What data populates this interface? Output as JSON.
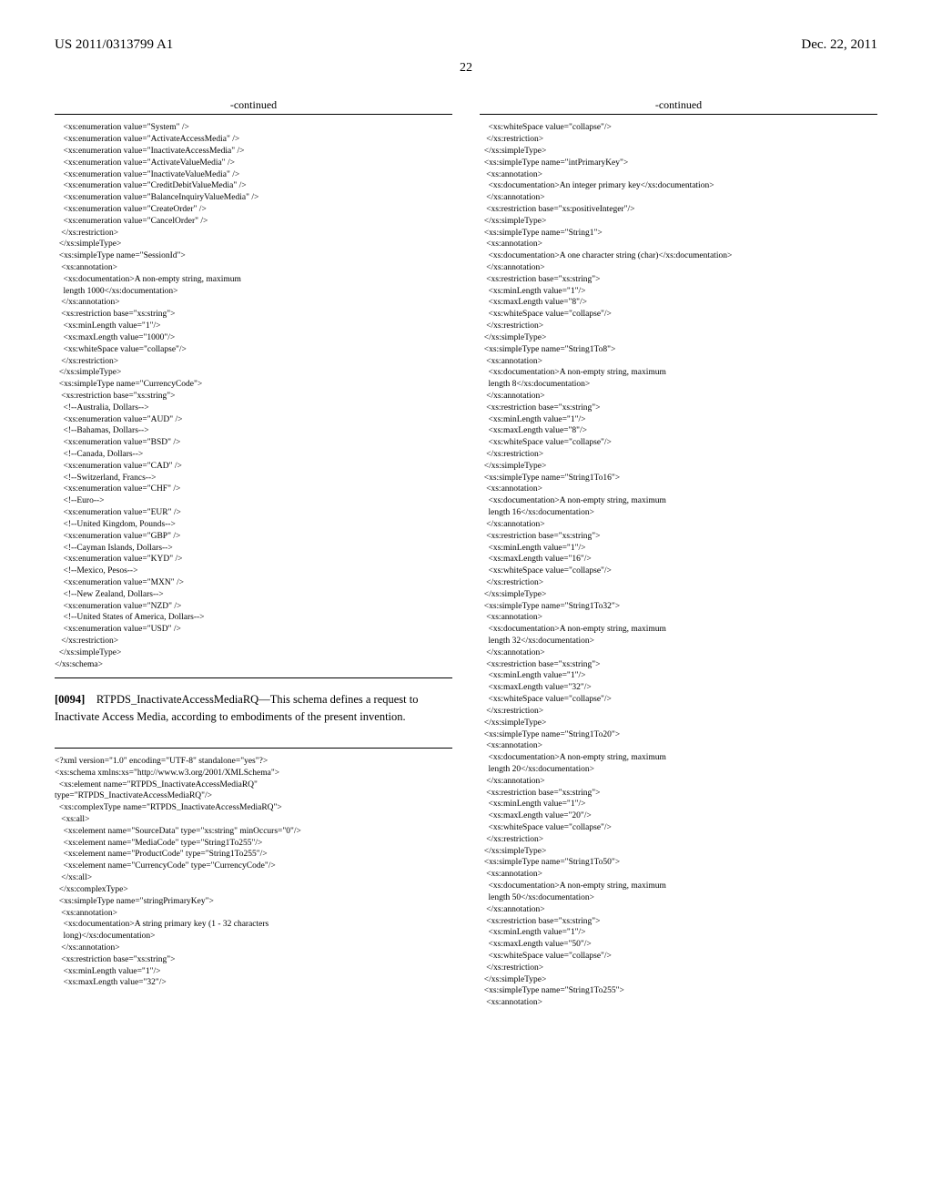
{
  "header": {
    "pub_number": "US 2011/0313799 A1",
    "pub_date": "Dec. 22, 2011"
  },
  "page_number": "22",
  "left": {
    "continued": "-continued",
    "code1": "    <xs:enumeration value=\"System\" />\n    <xs:enumeration value=\"ActivateAccessMedia\" />\n    <xs:enumeration value=\"InactivateAccessMedia\" />\n    <xs:enumeration value=\"ActivateValueMedia\" />\n    <xs:enumeration value=\"InactivateValueMedia\" />\n    <xs:enumeration value=\"CreditDebitValueMedia\" />\n    <xs:enumeration value=\"BalanceInquiryValueMedia\" />\n    <xs:enumeration value=\"CreateOrder\" />\n    <xs:enumeration value=\"CancelOrder\" />\n   </xs:restriction>\n  </xs:simpleType>\n  <xs:simpleType name=\"SessionId\">\n   <xs:annotation>\n    <xs:documentation>A non-empty string, maximum\n    length 1000</xs:documentation>\n   </xs:annotation>\n   <xs:restriction base=\"xs:string\">\n    <xs:minLength value=\"1\"/>\n    <xs:maxLength value=\"1000\"/>\n    <xs:whiteSpace value=\"collapse\"/>\n   </xs:restriction>\n  </xs:simpleType>\n  <xs:simpleType name=\"CurrencyCode\">\n   <xs:restriction base=\"xs:string\">\n    <!--Australia, Dollars-->\n    <xs:enumeration value=\"AUD\" />\n    <!--Bahamas, Dollars-->\n    <xs:enumeration value=\"BSD\" />\n    <!--Canada, Dollars-->\n    <xs:enumeration value=\"CAD\" />\n    <!--Switzerland, Francs-->\n    <xs:enumeration value=\"CHF\" />\n    <!--Euro-->\n    <xs:enumeration value=\"EUR\" />\n    <!--United Kingdom, Pounds-->\n    <xs:enumeration value=\"GBP\" />\n    <!--Cayman Islands, Dollars-->\n    <xs:enumeration value=\"KYD\" />\n    <!--Mexico, Pesos-->\n    <xs:enumeration value=\"MXN\" />\n    <!--New Zealand, Dollars-->\n    <xs:enumeration value=\"NZD\" />\n    <!--United States of America, Dollars-->\n    <xs:enumeration value=\"USD\" />\n   </xs:restriction>\n  </xs:simpleType>\n</xs:schema>",
    "para_num": "[0094]",
    "para_text": "RTPDS_InactivateAccessMediaRQ—This schema defines a request to Inactivate Access Media, according to embodiments of the present invention.",
    "code2": "<?xml version=\"1.0\" encoding=\"UTF-8\" standalone=\"yes\"?>\n<xs:schema xmlns:xs=\"http://www.w3.org/2001/XMLSchema\">\n  <xs:element name=\"RTPDS_InactivateAccessMediaRQ\"\ntype=\"RTPDS_InactivateAccessMediaRQ\"/>\n  <xs:complexType name=\"RTPDS_InactivateAccessMediaRQ\">\n   <xs:all>\n    <xs:element name=\"SourceData\" type=\"xs:string\" minOccurs=\"0\"/>\n    <xs:element name=\"MediaCode\" type=\"String1To255\"/>\n    <xs:element name=\"ProductCode\" type=\"String1To255\"/>\n    <xs:element name=\"CurrencyCode\" type=\"CurrencyCode\"/>\n   </xs:all>\n  </xs:complexType>\n  <xs:simpleType name=\"stringPrimaryKey\">\n   <xs:annotation>\n    <xs:documentation>A string primary key (1 - 32 characters\n    long)</xs:documentation>\n   </xs:annotation>\n   <xs:restriction base=\"xs:string\">\n    <xs:minLength value=\"1\"/>\n    <xs:maxLength value=\"32\"/>"
  },
  "right": {
    "continued": "-continued",
    "code": "    <xs:whiteSpace value=\"collapse\"/>\n   </xs:restriction>\n  </xs:simpleType>\n  <xs:simpleType name=\"intPrimaryKey\">\n   <xs:annotation>\n    <xs:documentation>An integer primary key</xs:documentation>\n   </xs:annotation>\n   <xs:restriction base=\"xs:positiveInteger\"/>\n  </xs:simpleType>\n  <xs:simpleType name=\"String1\">\n   <xs:annotation>\n    <xs:documentation>A one character string (char)</xs:documentation>\n   </xs:annotation>\n   <xs:restriction base=\"xs:string\">\n    <xs:minLength value=\"1\"/>\n    <xs:maxLength value=\"8\"/>\n    <xs:whiteSpace value=\"collapse\"/>\n   </xs:restriction>\n  </xs:simpleType>\n  <xs:simpleType name=\"String1To8\">\n   <xs:annotation>\n    <xs:documentation>A non-empty string, maximum\n    length 8</xs:documentation>\n   </xs:annotation>\n   <xs:restriction base=\"xs:string\">\n    <xs:minLength value=\"1\"/>\n    <xs:maxLength value=\"8\"/>\n    <xs:whiteSpace value=\"collapse\"/>\n   </xs:restriction>\n  </xs:simpleType>\n  <xs:simpleType name=\"String1To16\">\n   <xs:annotation>\n    <xs:documentation>A non-empty string, maximum\n    length 16</xs:documentation>\n   </xs:annotation>\n   <xs:restriction base=\"xs:string\">\n    <xs:minLength value=\"1\"/>\n    <xs:maxLength value=\"16\"/>\n    <xs:whiteSpace value=\"collapse\"/>\n   </xs:restriction>\n  </xs:simpleType>\n  <xs:simpleType name=\"String1To32\">\n   <xs:annotation>\n    <xs:documentation>A non-empty string, maximum\n    length 32</xs:documentation>\n   </xs:annotation>\n   <xs:restriction base=\"xs:string\">\n    <xs:minLength value=\"1\"/>\n    <xs:maxLength value=\"32\"/>\n    <xs:whiteSpace value=\"collapse\"/>\n   </xs:restriction>\n  </xs:simpleType>\n  <xs:simpleType name=\"String1To20\">\n   <xs:annotation>\n    <xs:documentation>A non-empty string, maximum\n    length 20</xs:documentation>\n   </xs:annotation>\n   <xs:restriction base=\"xs:string\">\n    <xs:minLength value=\"1\"/>\n    <xs:maxLength value=\"20\"/>\n    <xs:whiteSpace value=\"collapse\"/>\n   </xs:restriction>\n  </xs:simpleType>\n  <xs:simpleType name=\"String1To50\">\n   <xs:annotation>\n    <xs:documentation>A non-empty string, maximum\n    length 50</xs:documentation>\n   </xs:annotation>\n   <xs:restriction base=\"xs:string\">\n    <xs:minLength value=\"1\"/>\n    <xs:maxLength value=\"50\"/>\n    <xs:whiteSpace value=\"collapse\"/>\n   </xs:restriction>\n  </xs:simpleType>\n  <xs:simpleType name=\"String1To255\">\n   <xs:annotation>"
  }
}
